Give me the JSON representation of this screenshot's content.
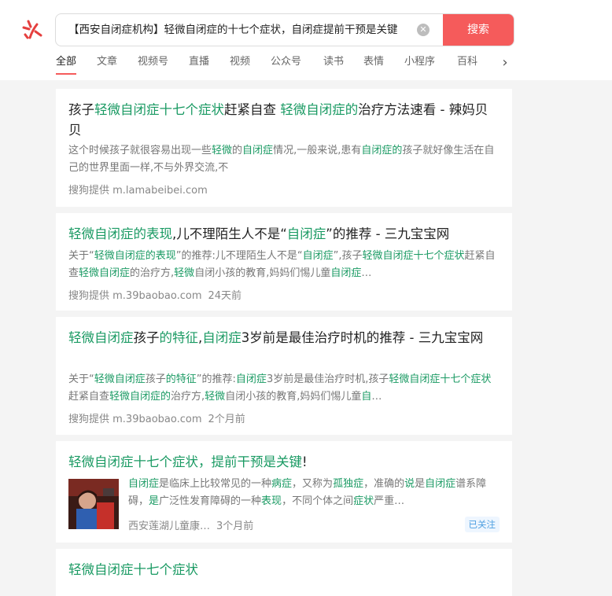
{
  "search": {
    "query": "【西安自闭症机构】轻微自闭症的十七个症状，自闭症提前干预是关键",
    "button": "搜索",
    "clear_icon": "close-circle-icon"
  },
  "tabs": [
    "全部",
    "文章",
    "视频号",
    "直播",
    "视频",
    "公众号",
    "读书",
    "表情",
    "小程序",
    "百科"
  ],
  "tab_more_icon": "chevron-right-icon",
  "results": [
    {
      "title_parts": [
        {
          "t": "孩子",
          "h": false
        },
        {
          "t": "轻微自闭症十七个症状",
          "h": true
        },
        {
          "t": "赶紧自查 ",
          "h": false
        },
        {
          "t": "轻微自闭症的",
          "h": true
        },
        {
          "t": "治疗方法速看 - 辣妈贝贝",
          "h": false
        }
      ],
      "snippet_parts": [
        {
          "t": "这个时候孩子就很容易出现一些",
          "h": false
        },
        {
          "t": "轻微",
          "h": true
        },
        {
          "t": "的",
          "h": false
        },
        {
          "t": "自闭症",
          "h": true
        },
        {
          "t": "情况,一般来说,患有",
          "h": false
        },
        {
          "t": "自闭症的",
          "h": true
        },
        {
          "t": "孩子就好像生活在自己的世界里面一样,不与外界交流,不",
          "h": false
        }
      ],
      "source": "搜狗提供 m.lamabeibei.com",
      "time": ""
    },
    {
      "title_parts": [
        {
          "t": "轻微自闭症的表现",
          "h": true
        },
        {
          "t": ",儿不理陌生人不是“",
          "h": false
        },
        {
          "t": "自闭症",
          "h": true
        },
        {
          "t": "”的推荐 - 三九宝宝网",
          "h": false
        }
      ],
      "snippet_parts": [
        {
          "t": "关于“",
          "h": false
        },
        {
          "t": "轻微自闭症的表现",
          "h": true
        },
        {
          "t": "”的推荐:儿不理陌生人不是“",
          "h": false
        },
        {
          "t": "自闭症",
          "h": true
        },
        {
          "t": "”,孩子",
          "h": false
        },
        {
          "t": "轻微自闭症十七个症状",
          "h": true
        },
        {
          "t": "赶紧自查",
          "h": false
        },
        {
          "t": "轻微自闭症",
          "h": true
        },
        {
          "t": "的治疗方,",
          "h": false
        },
        {
          "t": "轻微",
          "h": true
        },
        {
          "t": "自闭小孩的教育,妈妈们惕儿童",
          "h": false
        },
        {
          "t": "自闭症",
          "h": true
        },
        {
          "t": "…",
          "h": false
        }
      ],
      "source": "搜狗提供 m.39baobao.com",
      "time": "24天前"
    },
    {
      "title_parts": [
        {
          "t": "轻微自闭症",
          "h": true
        },
        {
          "t": "孩子",
          "h": false
        },
        {
          "t": "的特征",
          "h": true
        },
        {
          "t": ",",
          "h": false
        },
        {
          "t": "自闭症",
          "h": true
        },
        {
          "t": "3岁前是最佳治疗时机的推荐 - 三九宝宝网",
          "h": false
        }
      ],
      "snippet_parts": [
        {
          "t": "关于“",
          "h": false
        },
        {
          "t": "轻微自闭症",
          "h": true
        },
        {
          "t": "孩子",
          "h": false
        },
        {
          "t": "的特征",
          "h": true
        },
        {
          "t": "”的推荐:",
          "h": false
        },
        {
          "t": "自闭症",
          "h": true
        },
        {
          "t": "3岁前是最佳治疗时机,孩子",
          "h": false
        },
        {
          "t": "轻微自闭症十七个症状",
          "h": true
        },
        {
          "t": "赶紧自查",
          "h": false
        },
        {
          "t": "轻微自闭症的",
          "h": true
        },
        {
          "t": "治疗方,",
          "h": false
        },
        {
          "t": "轻微",
          "h": true
        },
        {
          "t": "自闭小孩的教育,妈妈们惕儿童",
          "h": false
        },
        {
          "t": "自",
          "h": true
        },
        {
          "t": "…",
          "h": false
        }
      ],
      "source": "搜狗提供 m.39baobao.com",
      "time": "2个月前"
    },
    {
      "title_parts": [
        {
          "t": "轻微自闭症十七个症状，提前干预是关键",
          "h": true
        },
        {
          "t": "!",
          "h": false
        }
      ],
      "snippet_parts": [
        {
          "t": "自闭症",
          "h": true
        },
        {
          "t": "是临床上比较常见的一种",
          "h": false
        },
        {
          "t": "病症",
          "h": true
        },
        {
          "t": "，又称为",
          "h": false
        },
        {
          "t": "孤独症",
          "h": true
        },
        {
          "t": "，准确的",
          "h": false
        },
        {
          "t": "说",
          "h": true
        },
        {
          "t": "是",
          "h": false
        },
        {
          "t": "自闭症",
          "h": true
        },
        {
          "t": "谱系障碍，",
          "h": false
        },
        {
          "t": "是",
          "h": true
        },
        {
          "t": "广泛性发育障碍的一种",
          "h": false
        },
        {
          "t": "表现",
          "h": true
        },
        {
          "t": "，不同个体之间",
          "h": false
        },
        {
          "t": "症状",
          "h": true
        },
        {
          "t": "严重…",
          "h": false
        }
      ],
      "source": "西安莲湖儿童康…",
      "time": "3个月前",
      "follow": "已关注"
    },
    {
      "title_parts": [
        {
          "t": "轻微自闭症十七个症状",
          "h": true
        }
      ]
    }
  ],
  "colors": {
    "accent": "#f55b5b",
    "highlight": "#1a9a63",
    "follow": "#4d9fe0"
  }
}
